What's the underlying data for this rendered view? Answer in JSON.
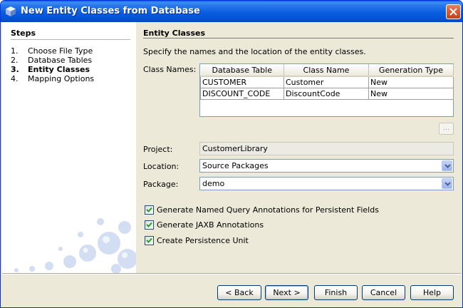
{
  "window": {
    "title": "New Entity Classes from Database",
    "colors": {
      "titlebar": "#0a5ee0",
      "close": "#d85a34",
      "frame": "#ece9d8"
    }
  },
  "steps": {
    "heading": "Steps",
    "items": [
      {
        "num": "1.",
        "label": "Choose File Type",
        "current": false
      },
      {
        "num": "2.",
        "label": "Database Tables",
        "current": false
      },
      {
        "num": "3.",
        "label": "Entity Classes",
        "current": true
      },
      {
        "num": "4.",
        "label": "Mapping Options",
        "current": false
      }
    ]
  },
  "panel": {
    "heading": "Entity Classes",
    "description": "Specify the names and the location of the entity classes.",
    "class_names_label": "Class Names:",
    "table": {
      "columns": [
        "Database Table",
        "Class Name",
        "Generation Type"
      ],
      "rows": [
        [
          "CUSTOMER",
          "Customer",
          "New"
        ],
        [
          "DISCOUNT_CODE",
          "DiscountCode",
          "New"
        ]
      ]
    },
    "browse_label": "...",
    "project_label": "Project:",
    "project_value": "CustomerLibrary",
    "location_label": "Location:",
    "location_value": "Source Packages",
    "package_label": "Package:",
    "package_value": "demo",
    "checkboxes": [
      {
        "label": "Generate Named Query Annotations for Persistent Fields",
        "checked": true
      },
      {
        "label": "Generate JAXB Annotations",
        "checked": true
      },
      {
        "label": "Create Persistence Unit",
        "checked": true
      }
    ]
  },
  "buttons": {
    "back": "< Back",
    "next": "Next >",
    "finish": "Finish",
    "cancel": "Cancel",
    "help": "Help"
  }
}
